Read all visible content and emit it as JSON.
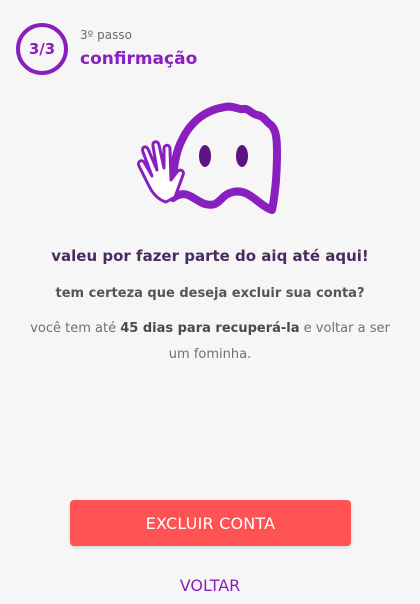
{
  "step": {
    "badge": "3/3",
    "label": "3º passo",
    "title": "confirmação"
  },
  "mascot": {
    "icon": "waving-ghost-icon",
    "color": "#8a1fbf"
  },
  "content": {
    "headline": "valeu por fazer parte do aiq até aqui!",
    "question": "tem certeza que deseja excluir sua conta?",
    "info_prefix": "você tem até ",
    "info_bold": "45 dias para recuperá-la",
    "info_suffix": " e voltar a ser um fominha."
  },
  "actions": {
    "delete_label": "EXCLUIR CONTA",
    "back_label": "VOLTAR"
  },
  "colors": {
    "brand": "#8a1fbf",
    "danger": "#ff5253",
    "background": "#f6f6f6"
  }
}
